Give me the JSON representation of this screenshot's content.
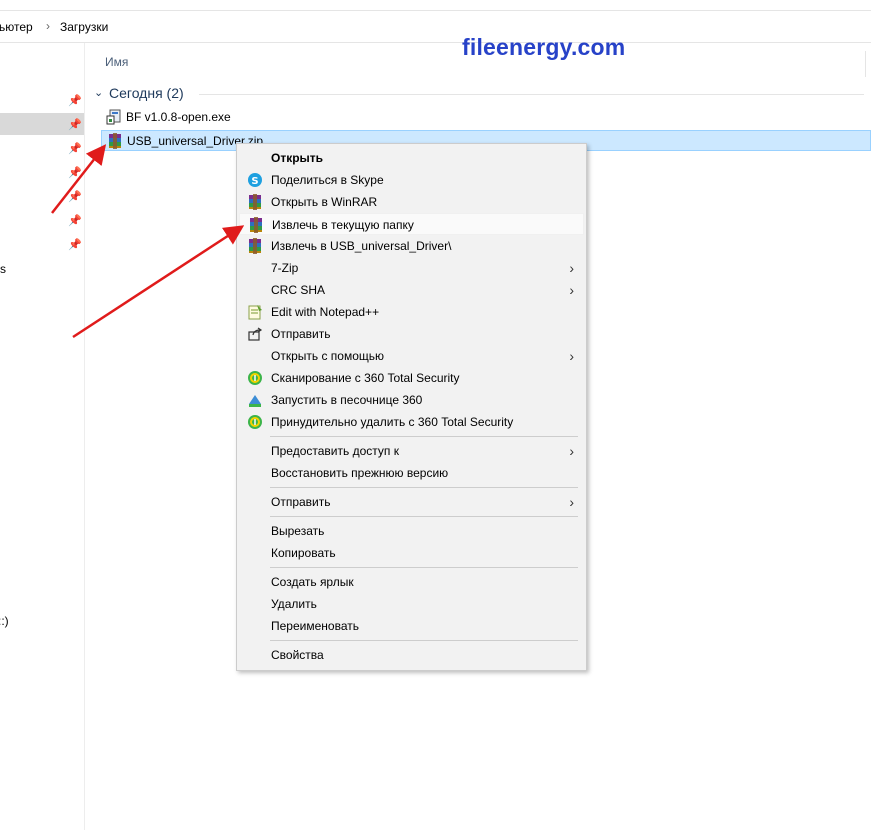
{
  "address_bar": {
    "crumb_computer": "ьютер",
    "crumb_downloads": "Загрузки",
    "separator": "›"
  },
  "navigation": {
    "fragment_s": "s",
    "fragment_drive": "::)"
  },
  "column_header": {
    "name": "Имя"
  },
  "watermark": "fileenergy.com",
  "group": {
    "chevron": "⌄",
    "title": "Сегодня (2)"
  },
  "files": [
    {
      "name": "BF v1.0.8-open.exe",
      "icon": "exe-installer-icon"
    },
    {
      "name": "USB_universal_Driver.zip",
      "icon": "winrar-archive-icon",
      "selected": true
    }
  ],
  "context_menu": {
    "items": [
      {
        "label": "Открыть",
        "bold": true
      },
      {
        "label": "Поделиться в Skype",
        "icon": "skype-icon"
      },
      {
        "label": "Открыть в WinRAR",
        "icon": "winrar-icon"
      },
      {
        "label": "Извлечь в текущую папку",
        "icon": "winrar-icon",
        "highlighted": true
      },
      {
        "label": "Извлечь в USB_universal_Driver\\",
        "icon": "winrar-icon"
      },
      {
        "label": "7-Zip",
        "submenu": true
      },
      {
        "label": "CRC SHA",
        "submenu": true
      },
      {
        "label": "Edit with Notepad++",
        "icon": "notepad-plus-plus-icon"
      },
      {
        "label": "Отправить",
        "icon": "share-icon"
      },
      {
        "label": "Открыть с помощью",
        "submenu": true
      },
      {
        "label": "Сканирование с 360 Total Security",
        "icon": "360-security-icon"
      },
      {
        "label": "Запустить в песочнице 360",
        "icon": "360-sandbox-icon"
      },
      {
        "label": "Принудительно удалить с  360 Total Security",
        "icon": "360-security-icon"
      },
      {
        "label": "Предоставить доступ к",
        "submenu": true
      },
      {
        "label": "Восстановить прежнюю версию"
      },
      {
        "label": "Отправить",
        "submenu": true
      },
      {
        "label": "Вырезать"
      },
      {
        "label": "Копировать"
      },
      {
        "label": "Создать ярлык"
      },
      {
        "label": "Удалить"
      },
      {
        "label": "Переименовать"
      },
      {
        "label": "Свойства"
      }
    ],
    "submenu_arrow": "›"
  },
  "colors": {
    "selection_bg": "#cce8ff",
    "watermark": "#2742c8",
    "annotation_arrow": "#e01b1b"
  }
}
